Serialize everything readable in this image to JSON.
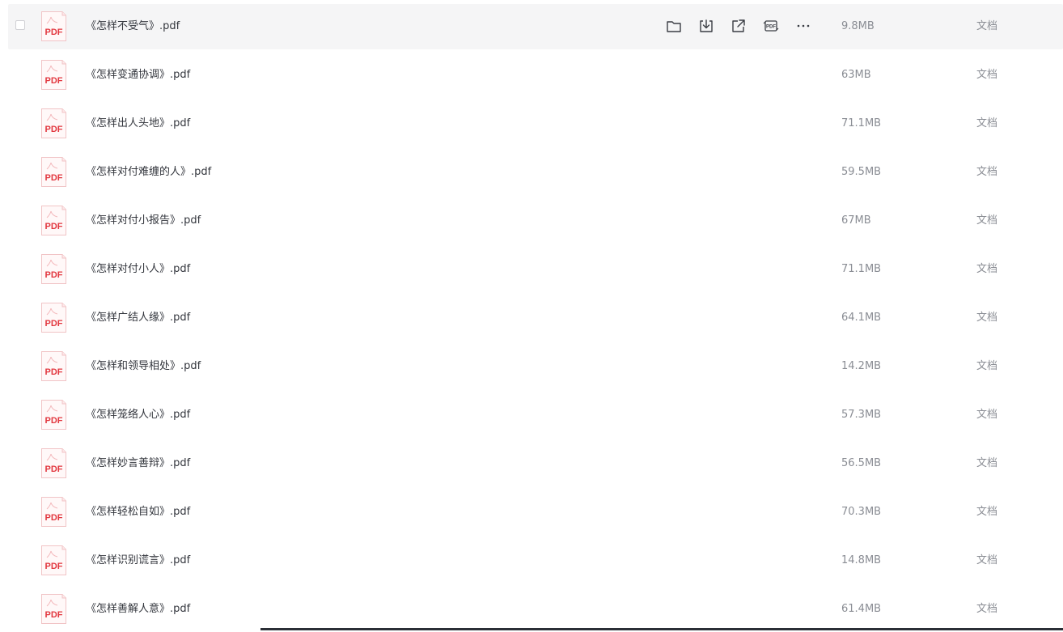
{
  "files": [
    {
      "name": "《怎样不受气》.pdf",
      "size": "9.8MB",
      "type": "文档"
    },
    {
      "name": "《怎样变通协调》.pdf",
      "size": "63MB",
      "type": "文档"
    },
    {
      "name": "《怎样出人头地》.pdf",
      "size": "71.1MB",
      "type": "文档"
    },
    {
      "name": "《怎样对付难缠的人》.pdf",
      "size": "59.5MB",
      "type": "文档"
    },
    {
      "name": "《怎样对付小报告》.pdf",
      "size": "67MB",
      "type": "文档"
    },
    {
      "name": "《怎样对付小人》.pdf",
      "size": "71.1MB",
      "type": "文档"
    },
    {
      "name": "《怎样广结人缘》.pdf",
      "size": "64.1MB",
      "type": "文档"
    },
    {
      "name": "《怎样和领导相处》.pdf",
      "size": "14.2MB",
      "type": "文档"
    },
    {
      "name": "《怎样笼络人心》.pdf",
      "size": "57.3MB",
      "type": "文档"
    },
    {
      "name": "《怎样妙言善辩》.pdf",
      "size": "56.5MB",
      "type": "文档"
    },
    {
      "name": "《怎样轻松自如》.pdf",
      "size": "70.3MB",
      "type": "文档"
    },
    {
      "name": "《怎样识别谎言》.pdf",
      "size": "14.8MB",
      "type": "文档"
    },
    {
      "name": "《怎样善解人意》.pdf",
      "size": "61.4MB",
      "type": "文档"
    }
  ],
  "file_icon": {
    "name": "pdf-file-icon",
    "label": "PDF",
    "accent": "#e2373f"
  },
  "hover_actions": [
    "folder-icon",
    "download-icon",
    "share-icon",
    "pdf-convert-icon",
    "more-icon"
  ]
}
